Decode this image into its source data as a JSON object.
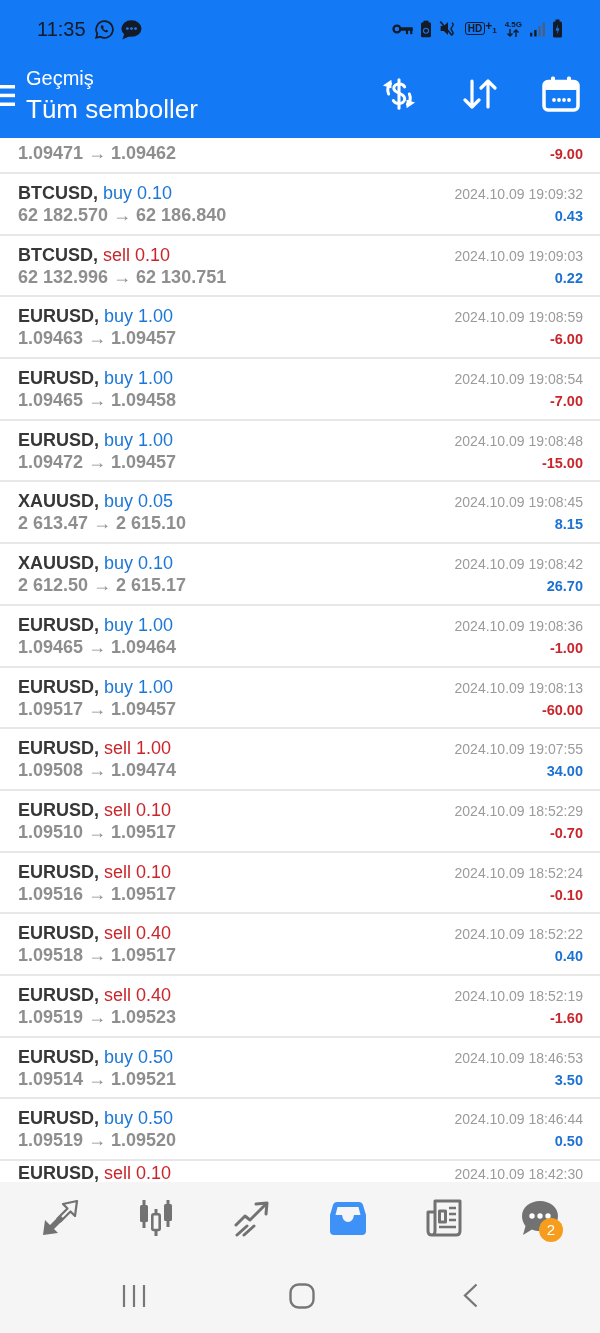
{
  "status_bar": {
    "time": "11:35",
    "volte": "HD",
    "volte_suffix": "+$_{1}$",
    "network": "4.5G"
  },
  "toolbar": {
    "subtitle": "Geçmiş",
    "title": "Tüm semboller"
  },
  "deals": [
    {
      "kind": "cut-top",
      "prices": "1.09471 → 1.09462",
      "profit": "-9.00",
      "loss": true
    },
    {
      "kind": "full",
      "symbol": "BTCUSD,",
      "order": "buy 0.10",
      "sell": false,
      "time": "2024.10.09 19:09:32",
      "prices": "62 182.570 → 62 186.840",
      "profit": "0.43",
      "loss": false
    },
    {
      "kind": "full",
      "symbol": "BTCUSD,",
      "order": "sell 0.10",
      "sell": true,
      "time": "2024.10.09 19:09:03",
      "prices": "62 132.996 → 62 130.751",
      "profit": "0.22",
      "loss": false
    },
    {
      "kind": "full",
      "symbol": "EURUSD,",
      "order": "buy 1.00",
      "sell": false,
      "time": "2024.10.09 19:08:59",
      "prices": "1.09463 → 1.09457",
      "profit": "-6.00",
      "loss": true
    },
    {
      "kind": "full",
      "symbol": "EURUSD,",
      "order": "buy 1.00",
      "sell": false,
      "time": "2024.10.09 19:08:54",
      "prices": "1.09465 → 1.09458",
      "profit": "-7.00",
      "loss": true
    },
    {
      "kind": "full",
      "symbol": "EURUSD,",
      "order": "buy 1.00",
      "sell": false,
      "time": "2024.10.09 19:08:48",
      "prices": "1.09472 → 1.09457",
      "profit": "-15.00",
      "loss": true
    },
    {
      "kind": "full",
      "symbol": "XAUUSD,",
      "order": "buy 0.05",
      "sell": false,
      "time": "2024.10.09 19:08:45",
      "prices": "2 613.47 → 2 615.10",
      "profit": "8.15",
      "loss": false
    },
    {
      "kind": "full",
      "symbol": "XAUUSD,",
      "order": "buy 0.10",
      "sell": false,
      "time": "2024.10.09 19:08:42",
      "prices": "2 612.50 → 2 615.17",
      "profit": "26.70",
      "loss": false
    },
    {
      "kind": "full",
      "symbol": "EURUSD,",
      "order": "buy 1.00",
      "sell": false,
      "time": "2024.10.09 19:08:36",
      "prices": "1.09465 → 1.09464",
      "profit": "-1.00",
      "loss": true
    },
    {
      "kind": "full",
      "symbol": "EURUSD,",
      "order": "buy 1.00",
      "sell": false,
      "time": "2024.10.09 19:08:13",
      "prices": "1.09517 → 1.09457",
      "profit": "-60.00",
      "loss": true
    },
    {
      "kind": "full",
      "symbol": "EURUSD,",
      "order": "sell 1.00",
      "sell": true,
      "time": "2024.10.09 19:07:55",
      "prices": "1.09508 → 1.09474",
      "profit": "34.00",
      "loss": false
    },
    {
      "kind": "full",
      "symbol": "EURUSD,",
      "order": "sell 0.10",
      "sell": true,
      "time": "2024.10.09 18:52:29",
      "prices": "1.09510 → 1.09517",
      "profit": "-0.70",
      "loss": true
    },
    {
      "kind": "full",
      "symbol": "EURUSD,",
      "order": "sell 0.10",
      "sell": true,
      "time": "2024.10.09 18:52:24",
      "prices": "1.09516 → 1.09517",
      "profit": "-0.10",
      "loss": true
    },
    {
      "kind": "full",
      "symbol": "EURUSD,",
      "order": "sell 0.40",
      "sell": true,
      "time": "2024.10.09 18:52:22",
      "prices": "1.09518 → 1.09517",
      "profit": "0.40",
      "loss": false
    },
    {
      "kind": "full",
      "symbol": "EURUSD,",
      "order": "sell 0.40",
      "sell": true,
      "time": "2024.10.09 18:52:19",
      "prices": "1.09519 → 1.09523",
      "profit": "-1.60",
      "loss": true
    },
    {
      "kind": "full",
      "symbol": "EURUSD,",
      "order": "buy 0.50",
      "sell": false,
      "time": "2024.10.09 18:46:53",
      "prices": "1.09514 → 1.09521",
      "profit": "3.50",
      "loss": false
    },
    {
      "kind": "full",
      "symbol": "EURUSD,",
      "order": "buy 0.50",
      "sell": false,
      "time": "2024.10.09 18:46:44",
      "prices": "1.09519 → 1.09520",
      "profit": "0.50",
      "loss": false
    },
    {
      "kind": "cut-bottom",
      "symbol": "EURUSD,",
      "order": "sell 0.10",
      "sell": true,
      "time": "2024.10.09 18:42:30"
    }
  ],
  "bottom_nav": {
    "tabs": [
      {
        "kind": "quotes",
        "selected": false
      },
      {
        "kind": "chart",
        "selected": false
      },
      {
        "kind": "trade",
        "selected": false
      },
      {
        "kind": "history",
        "selected": true
      },
      {
        "kind": "news",
        "selected": false
      },
      {
        "kind": "chat",
        "selected": false,
        "badge": "2"
      }
    ]
  }
}
